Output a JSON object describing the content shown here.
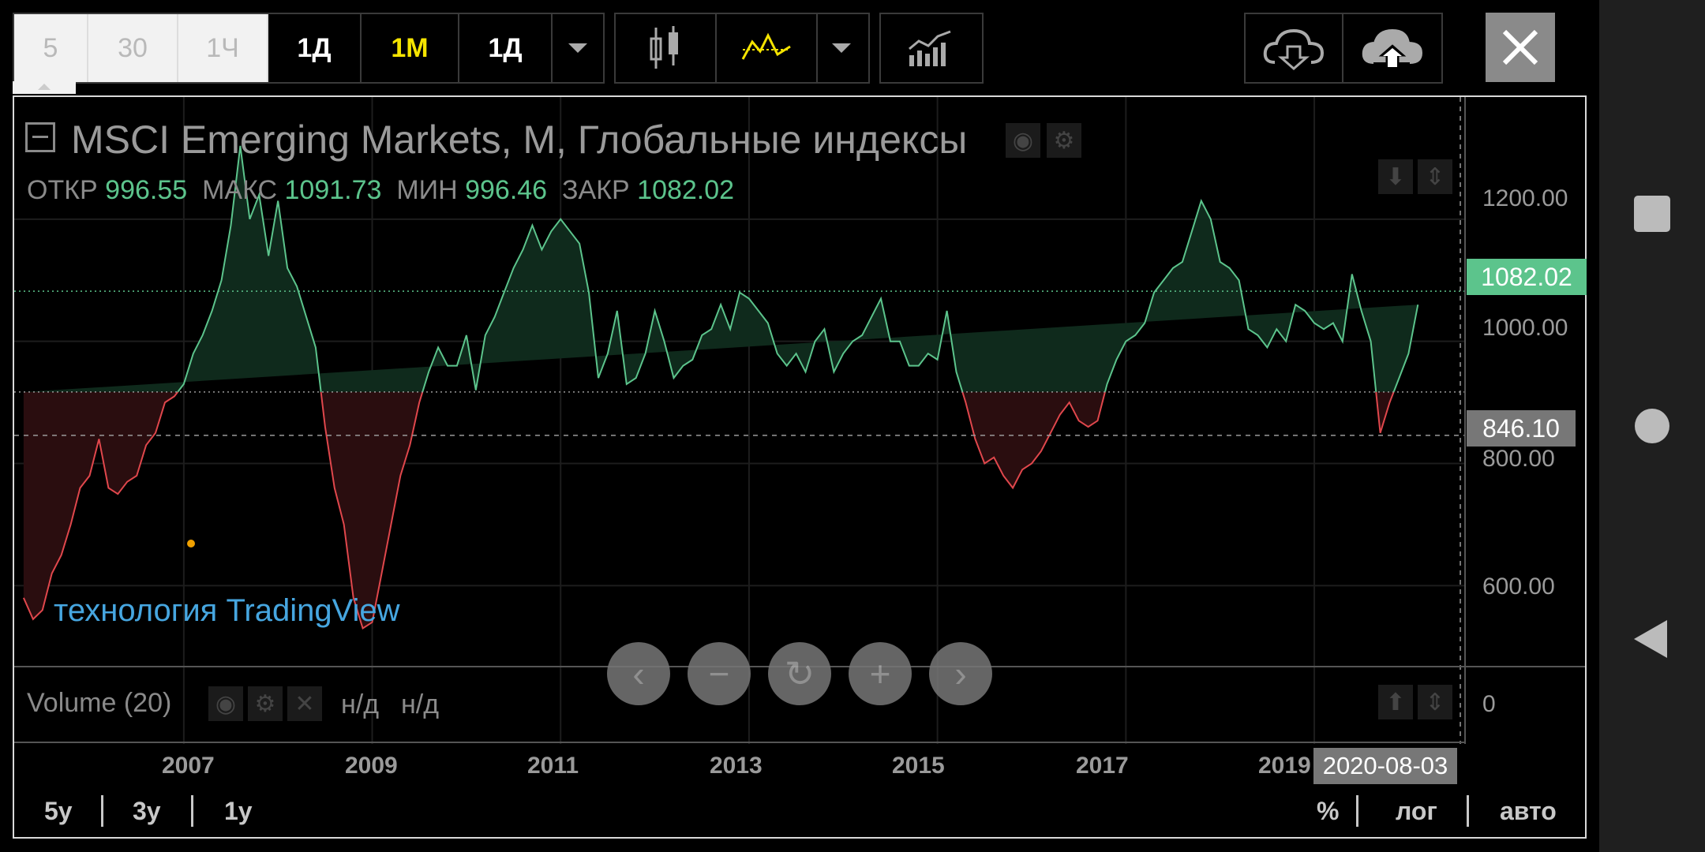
{
  "toolbar": {
    "intervals": [
      {
        "label": "5",
        "state": "inactive"
      },
      {
        "label": "30",
        "state": "inactive"
      },
      {
        "label": "1Ч",
        "state": "inactive"
      },
      {
        "label": "1Д",
        "state": "active"
      },
      {
        "label": "1М",
        "state": "selected"
      },
      {
        "label": "1Д",
        "state": "active"
      }
    ],
    "close_icon": "close-icon",
    "download_icon": "cloud-download-icon",
    "upload_icon": "cloud-upload-icon",
    "candle_icon": "candlestick-icon",
    "line_style_icon": "line-style-icon",
    "indicators_icon": "indicators-icon"
  },
  "legend": {
    "title": "MSCI Emerging Markets, M, Глобальные индексы",
    "ohlc": [
      {
        "label": "ОТКР",
        "value": "996.55"
      },
      {
        "label": "МАКС",
        "value": "1091.73"
      },
      {
        "label": "МИН",
        "value": "996.46"
      },
      {
        "label": "ЗАКР",
        "value": "1082.02"
      }
    ]
  },
  "watermark": "технология TradingView",
  "volume": {
    "label": "Volume (20)",
    "v1": "н/д",
    "v2": "н/д",
    "axis_zero": "0"
  },
  "price_axis": {
    "ticks": [
      "1200.00",
      "1000.00",
      "800.00",
      "600.00"
    ],
    "last_price": "1082.02",
    "crosshair_price": "846.10"
  },
  "time_axis": {
    "ticks": [
      "2007",
      "2009",
      "2011",
      "2013",
      "2015",
      "2017",
      "2019"
    ],
    "crosshair_date": "2020-08-03"
  },
  "ranges": [
    "5у",
    "3у",
    "1у"
  ],
  "scale_opts": [
    "%",
    "лог",
    "авто"
  ],
  "colors": {
    "up": "#5cc48c",
    "down": "#e0474c",
    "up_fill": "#0f2a1c",
    "down_fill": "#2a0d0f",
    "selected": "#f5e400"
  },
  "chart_data": {
    "type": "area",
    "x_range": [
      2005.2,
      2020.6
    ],
    "ylim": [
      470,
      1400
    ],
    "baseline": 917,
    "x": [
      2005.3,
      2005.4,
      2005.5,
      2005.6,
      2005.7,
      2005.8,
      2005.9,
      2006.0,
      2006.1,
      2006.2,
      2006.3,
      2006.4,
      2006.5,
      2006.6,
      2006.7,
      2006.8,
      2006.9,
      2007.0,
      2007.1,
      2007.2,
      2007.3,
      2007.4,
      2007.5,
      2007.6,
      2007.7,
      2007.8,
      2007.9,
      2008.0,
      2008.1,
      2008.2,
      2008.3,
      2008.4,
      2008.5,
      2008.6,
      2008.7,
      2008.8,
      2008.9,
      2009.0,
      2009.1,
      2009.2,
      2009.3,
      2009.4,
      2009.5,
      2009.6,
      2009.7,
      2009.8,
      2009.9,
      2010.0,
      2010.1,
      2010.2,
      2010.3,
      2010.4,
      2010.5,
      2010.6,
      2010.7,
      2010.8,
      2010.9,
      2011.0,
      2011.1,
      2011.2,
      2011.3,
      2011.4,
      2011.5,
      2011.6,
      2011.7,
      2011.8,
      2011.9,
      2012.0,
      2012.1,
      2012.2,
      2012.3,
      2012.4,
      2012.5,
      2012.6,
      2012.7,
      2012.8,
      2012.9,
      2013.0,
      2013.1,
      2013.2,
      2013.3,
      2013.4,
      2013.5,
      2013.6,
      2013.7,
      2013.8,
      2013.9,
      2014.0,
      2014.1,
      2014.2,
      2014.3,
      2014.4,
      2014.5,
      2014.6,
      2014.7,
      2014.8,
      2014.9,
      2015.0,
      2015.1,
      2015.2,
      2015.3,
      2015.4,
      2015.5,
      2015.6,
      2015.7,
      2015.8,
      2015.9,
      2016.0,
      2016.1,
      2016.2,
      2016.3,
      2016.4,
      2016.5,
      2016.6,
      2016.7,
      2016.8,
      2016.9,
      2017.0,
      2017.1,
      2017.2,
      2017.3,
      2017.4,
      2017.5,
      2017.6,
      2017.7,
      2017.8,
      2017.9,
      2018.0,
      2018.1,
      2018.2,
      2018.3,
      2018.4,
      2018.5,
      2018.6,
      2018.7,
      2018.8,
      2018.9,
      2019.0,
      2019.1,
      2019.2,
      2019.3,
      2019.4,
      2019.5,
      2019.6,
      2019.7,
      2019.8,
      2019.9,
      2020.0,
      2020.1,
      2020.2,
      2020.3,
      2020.4,
      2020.5,
      2020.6
    ],
    "values": [
      580,
      545,
      560,
      620,
      650,
      700,
      760,
      780,
      840,
      760,
      750,
      770,
      780,
      830,
      850,
      900,
      910,
      930,
      980,
      1010,
      1050,
      1100,
      1190,
      1320,
      1200,
      1240,
      1140,
      1230,
      1120,
      1090,
      1040,
      990,
      860,
      760,
      700,
      580,
      530,
      540,
      620,
      700,
      780,
      830,
      900,
      950,
      990,
      960,
      960,
      1010,
      920,
      1010,
      1040,
      1080,
      1120,
      1150,
      1190,
      1150,
      1180,
      1200,
      1180,
      1160,
      1080,
      940,
      980,
      1050,
      930,
      940,
      980,
      1050,
      1000,
      940,
      960,
      970,
      1010,
      1020,
      1060,
      1020,
      1080,
      1070,
      1050,
      1030,
      980,
      960,
      980,
      950,
      1000,
      1020,
      950,
      980,
      1000,
      1010,
      1040,
      1070,
      1000,
      1000,
      960,
      960,
      980,
      970,
      1050,
      950,
      900,
      840,
      800,
      810,
      780,
      760,
      790,
      800,
      820,
      850,
      880,
      900,
      870,
      860,
      870,
      930,
      970,
      1000,
      1010,
      1030,
      1080,
      1100,
      1120,
      1130,
      1180,
      1230,
      1200,
      1130,
      1120,
      1100,
      1020,
      1010,
      990,
      1020,
      1000,
      1060,
      1050,
      1030,
      1020,
      1030,
      1000,
      1110,
      1050,
      1000,
      850,
      900,
      940,
      980,
      1060
    ]
  }
}
